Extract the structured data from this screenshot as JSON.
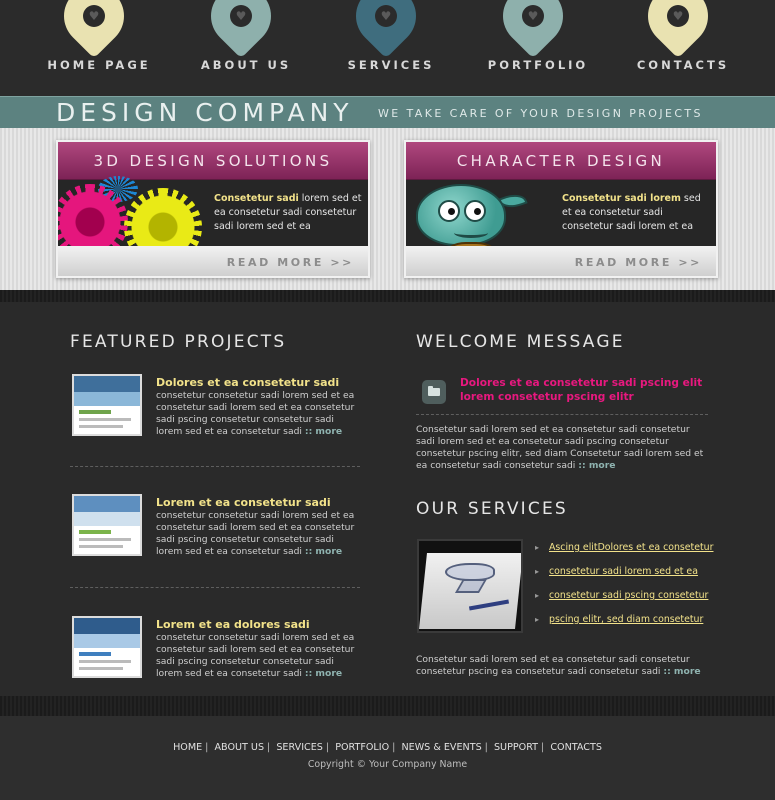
{
  "nav": {
    "items": [
      {
        "label": "HOME PAGE",
        "color": "#e9e2b1"
      },
      {
        "label": "ABOUT US",
        "color": "#8eb0ac"
      },
      {
        "label": "SERVICES",
        "color": "#3f6d7e"
      },
      {
        "label": "PORTFOLIO",
        "color": "#8eb0ac"
      },
      {
        "label": "CONTACTS",
        "color": "#e9e2b1"
      }
    ]
  },
  "header": {
    "brand": "DESIGN COMPANY",
    "tagline": "WE TAKE CARE OF YOUR DESIGN PROJECTS"
  },
  "features": [
    {
      "title": "3D DESIGN SOLUTIONS",
      "lead": "Consetetur sadi",
      "text": " lorem sed  et ea consetetur sadi consetetur sadi lorem sed  et ea",
      "more": "READ MORE >>"
    },
    {
      "title": "CHARACTER DESIGN",
      "lead": "Consetetur sadi lorem",
      "text": " sed et ea consetetur sadi consetetur sadi lorem et ea",
      "more": "READ MORE >>"
    }
  ],
  "featured": {
    "title": "FEATURED PROJECTS",
    "projects": [
      {
        "title": "Dolores et ea consetetur sadi",
        "body": "consetetur consetetur sadi lorem sed  et ea consetetur sadi lorem sed  et ea consetetur sadi pscing consetetur consetetur sadi lorem sed  et ea consetetur sadi",
        "more": ":: more"
      },
      {
        "title": "Lorem et ea consetetur sadi",
        "body": "consetetur consetetur sadi lorem sed  et ea consetetur sadi lorem sed  et ea consetetur sadi pscing consetetur consetetur sadi lorem sed  et ea consetetur sadi",
        "more": ":: more"
      },
      {
        "title": "Lorem et ea dolores sadi",
        "body": "consetetur consetetur sadi lorem sed  et ea consetetur sadi lorem sed  et ea consetetur sadi pscing consetetur consetetur sadi lorem sed  et ea consetetur sadi",
        "more": ":: more"
      }
    ]
  },
  "welcome": {
    "title": "WELCOME MESSAGE",
    "headline": "Dolores et ea consetetur sadi pscing elit lorem consetetur pscing elitr",
    "body": "Consetetur sadi lorem sed  et ea consetetur sadi consetetur sadi lorem sed  et ea consetetur sadi pscing  consetetur consetetur pscing elitr, sed diam Consetetur sadi lorem sed  et ea consetetur sadi consetetur sadi",
    "more": ":: more"
  },
  "services": {
    "title": "OUR SERVICES",
    "items": [
      "Ascing elitDolores et ea consetetur",
      "consetetur sadi lorem sed  et ea",
      "consetetur sadi pscing consetetur",
      "pscing elitr, sed diam consetetur"
    ],
    "body": "Consetetur sadi lorem sed  et ea consetetur sadi consetetur consetetur pscing ea consetetur sadi consetetur sadi",
    "more": ":: more"
  },
  "footer": {
    "links": [
      "HOME",
      "ABOUT US",
      "SERVICES",
      "PORTFOLIO",
      "NEWS & EVENTS",
      "SUPPORT",
      "CONTACTS"
    ],
    "copyright": "Copyright © Your Company Name"
  }
}
